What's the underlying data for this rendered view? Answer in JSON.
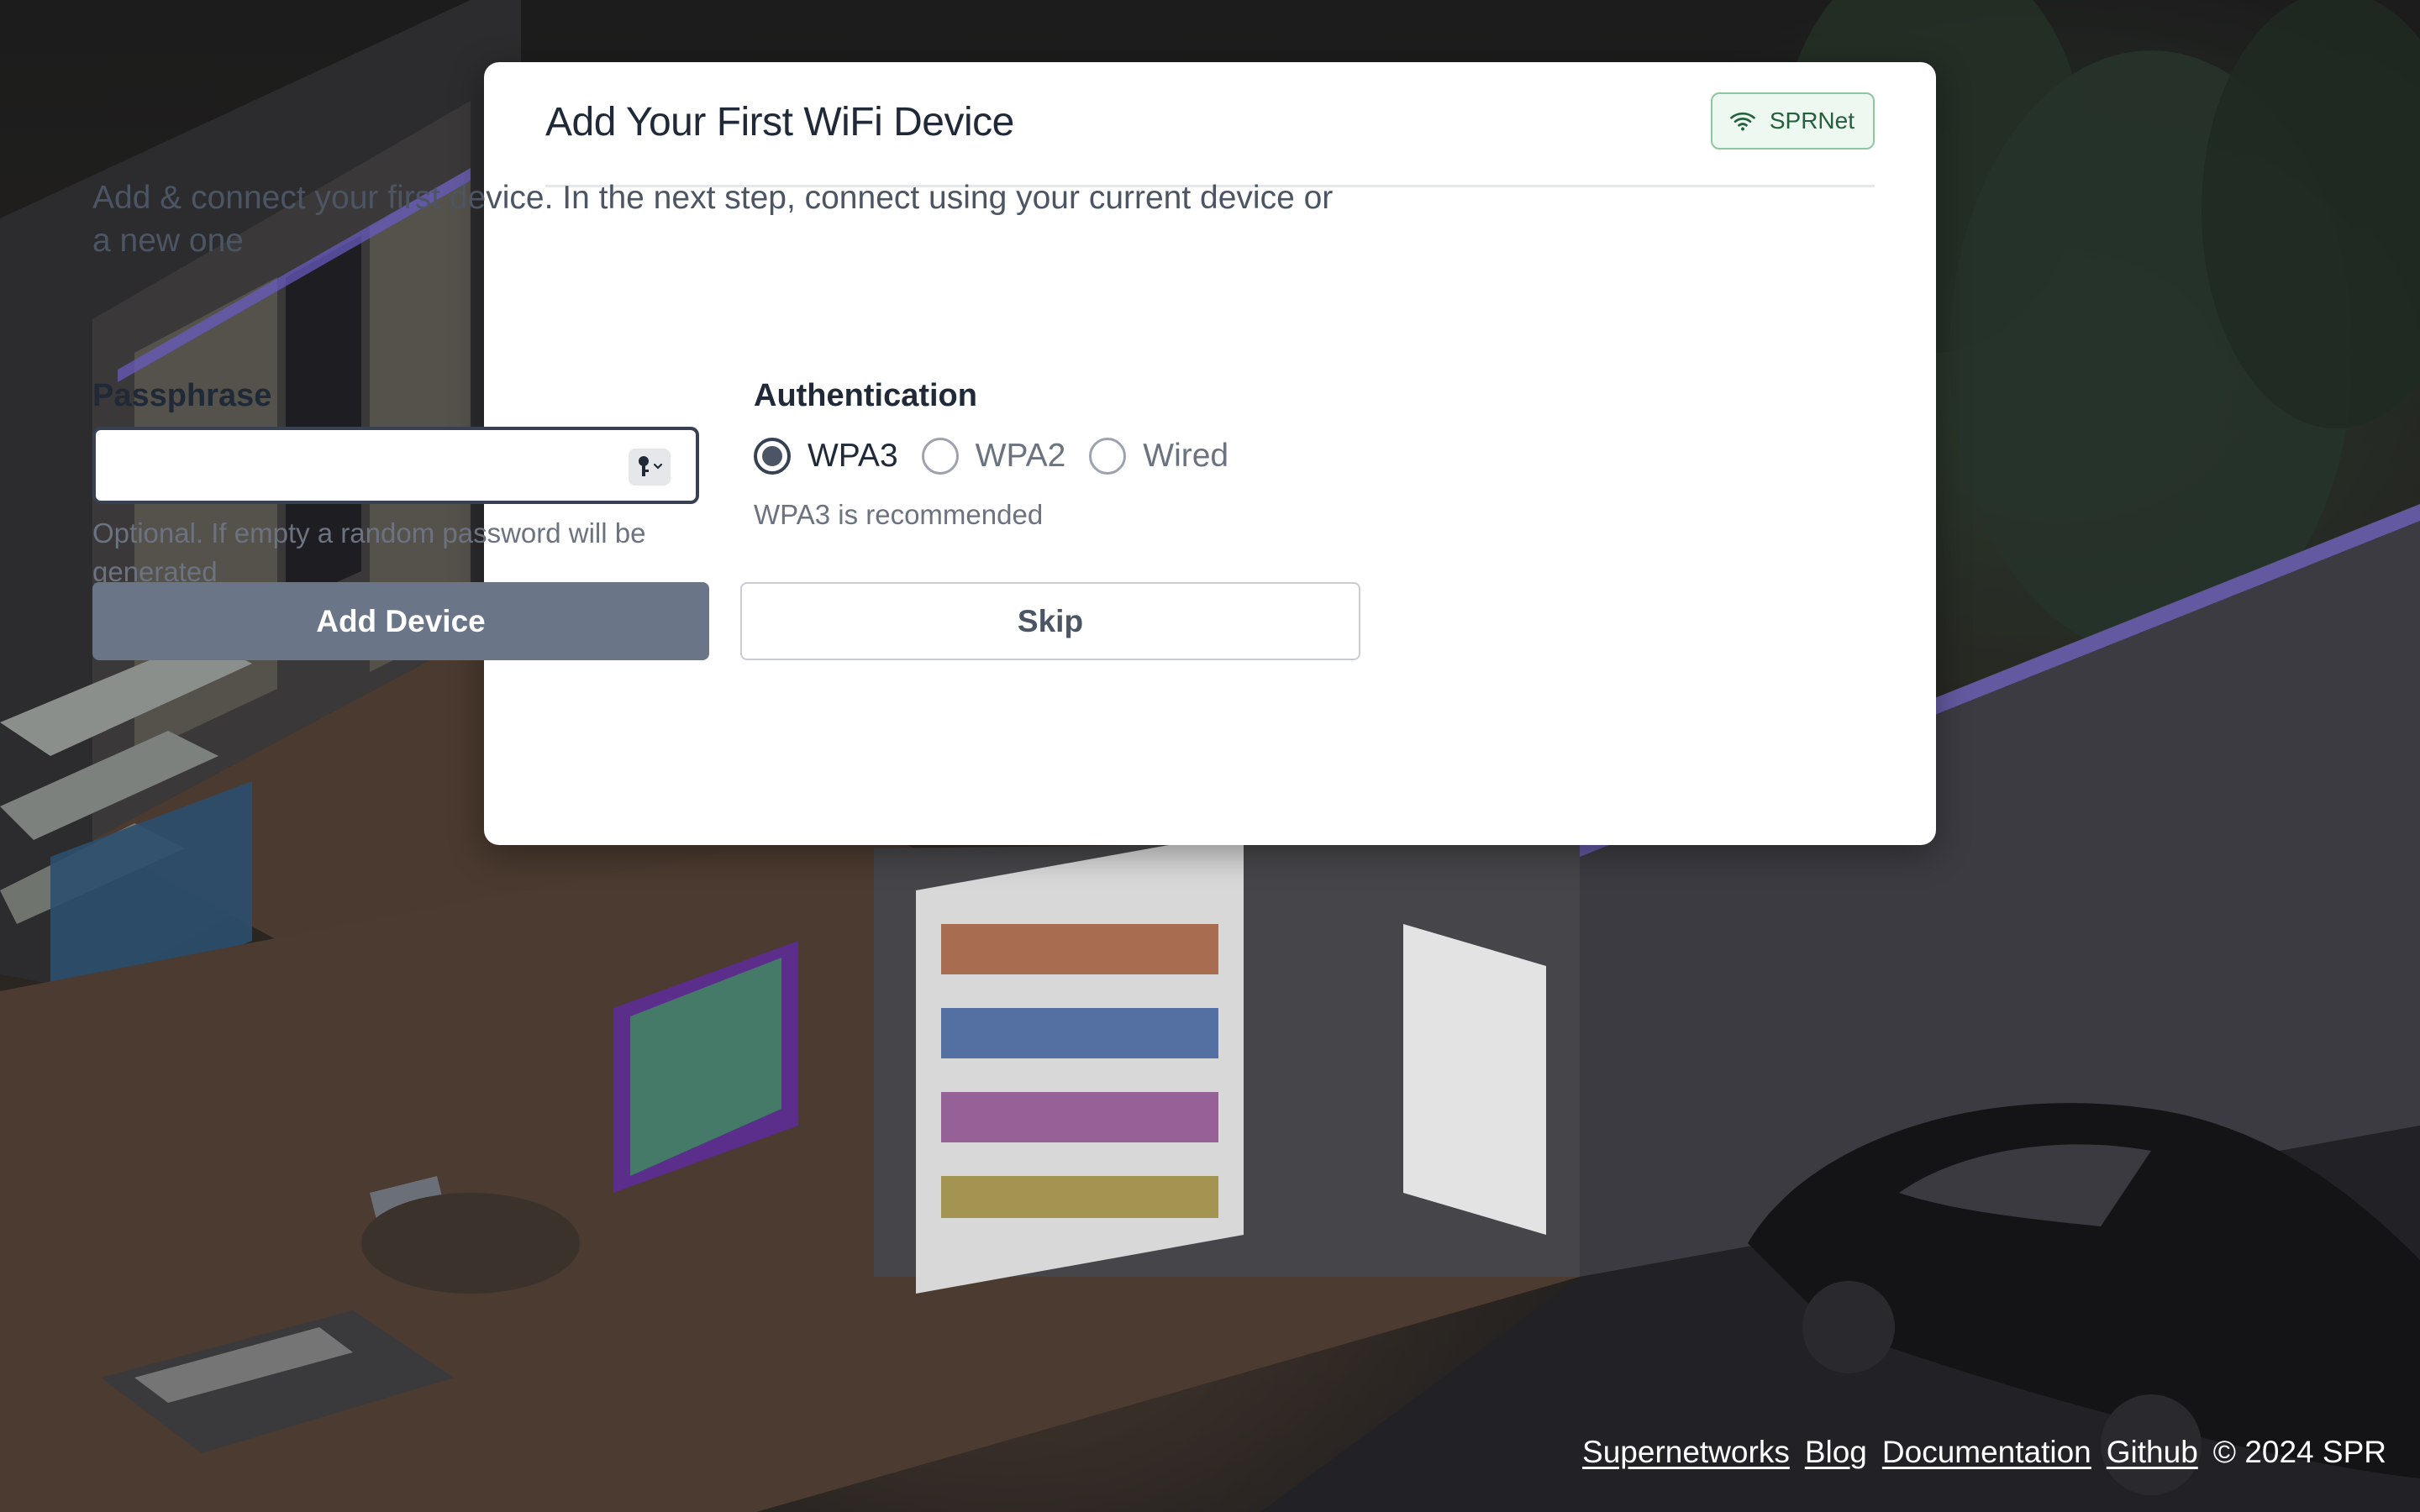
{
  "modal": {
    "title": "Add Your First WiFi Device",
    "network_badge": {
      "label": "SPRNet",
      "icon": "wifi-icon"
    },
    "intro": "Add & connect your first device. In the next step, connect using your current device or a new one"
  },
  "passphrase": {
    "label": "Passphrase",
    "value": "",
    "placeholder": "",
    "key_icon": "key-icon",
    "help": "Optional. If empty a random password will be generated"
  },
  "authentication": {
    "label": "Authentication",
    "options": [
      {
        "label": "WPA3",
        "checked": true
      },
      {
        "label": "WPA2",
        "checked": false
      },
      {
        "label": "Wired",
        "checked": false
      }
    ],
    "help": "WPA3 is recommended"
  },
  "actions": {
    "add_label": "Add Device",
    "skip_label": "Skip"
  },
  "footer": {
    "links": [
      "Supernetworks",
      "Blog",
      "Documentation",
      "Github"
    ],
    "copyright": "© 2024 SPR"
  },
  "colors": {
    "primary_button": "#6b7588",
    "badge_bg": "#edf8f0",
    "badge_border": "#8cc7a0",
    "badge_text": "#25603b"
  }
}
